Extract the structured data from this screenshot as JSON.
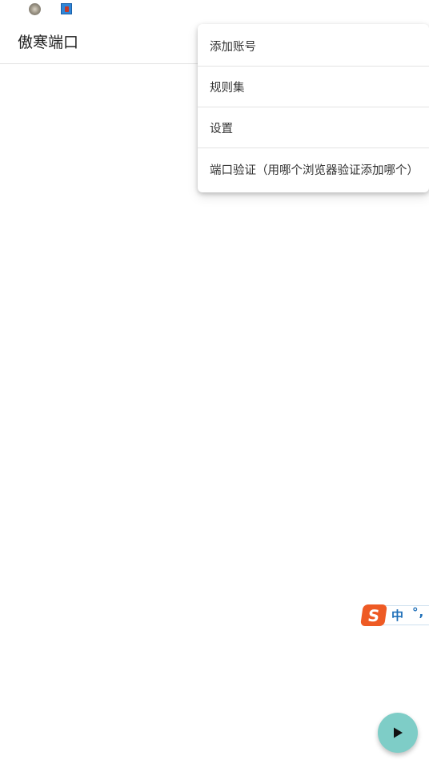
{
  "status_bar": {
    "icons": [
      "app-notification-icon",
      "app-notification-icon-2"
    ]
  },
  "app_bar": {
    "title": "傲寒端口"
  },
  "menu": {
    "items": [
      {
        "label": "添加账号"
      },
      {
        "label": "规则集"
      },
      {
        "label": "设置"
      },
      {
        "label": "端口验证（用哪个浏览器验证添加哪个）"
      }
    ]
  },
  "ime": {
    "logo": "S",
    "mode": "中",
    "punct": "°,"
  },
  "fab": {
    "icon": "play-icon",
    "color": "#7ecdc7"
  }
}
